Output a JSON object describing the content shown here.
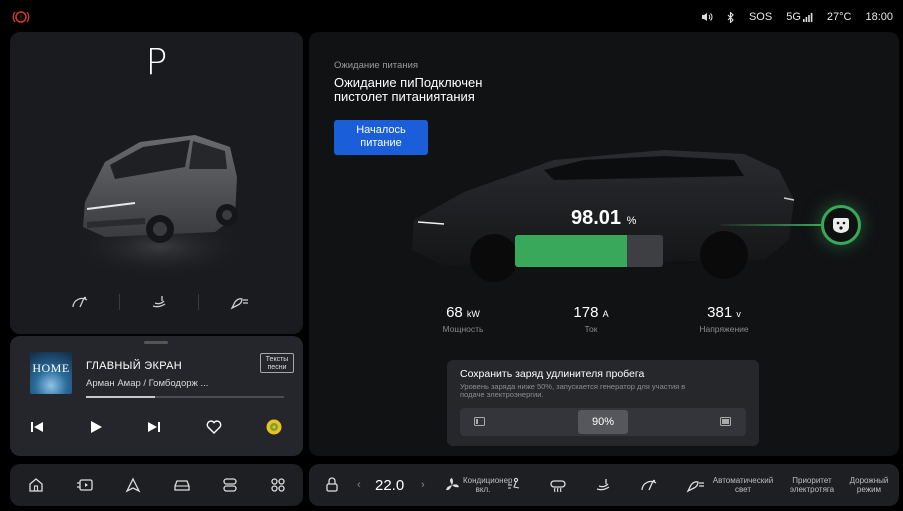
{
  "status_bar": {
    "left_icon": "parking-brake-icon",
    "volume_icon": "volume-icon",
    "bluetooth_icon": "bluetooth-icon",
    "sos": "SOS",
    "network": "5G",
    "temperature": "27°C",
    "time": "18:00"
  },
  "vehicle": {
    "gear": "P",
    "quick_icons": [
      "wiper-icon",
      "seat-icon",
      "headlight-icon"
    ]
  },
  "media": {
    "album_text": "HOME",
    "title": "ГЛАВНЫЙ ЭКРАН",
    "artist": "Арман Амар / Гомбодорж ...",
    "lyrics_label": "Тексты песни",
    "progress": 0.35,
    "controls": [
      "previous-icon",
      "play-icon",
      "next-icon",
      "heart-icon",
      "music-app-icon"
    ]
  },
  "charging": {
    "status_small": "Ожидание питания",
    "status_big": "Ожидание пиПодключен пистолет питаниятания",
    "start_button": "Началось питание",
    "battery_value": "98.01",
    "battery_unit": "%",
    "battery_fill": 0.76,
    "accent_color": "#3aa85a",
    "stats": [
      {
        "value": "68",
        "unit": "kW",
        "label": "Мощность"
      },
      {
        "value": "178",
        "unit": "A",
        "label": "Ток"
      },
      {
        "value": "381",
        "unit": "v",
        "label": "Напряжение"
      }
    ]
  },
  "range_extender": {
    "title": "Сохранить заряд удлинителя пробега",
    "description": "Уровень заряда ниже 50%, запускается генератор для участия в подаче электроэнергии.",
    "value": "90%"
  },
  "dock": {
    "apps": [
      "home-icon",
      "media-icon",
      "navigation-icon",
      "car-icon",
      "hvac-icon",
      "apps-grid-icon"
    ]
  },
  "climate_bar": {
    "temperature": "22.0",
    "ac_label": "Кондиционер вкл.",
    "auto_light": "Автоматический свет",
    "priority": "Приоритет электротяга",
    "drive_mode": "Дорожный режим"
  }
}
